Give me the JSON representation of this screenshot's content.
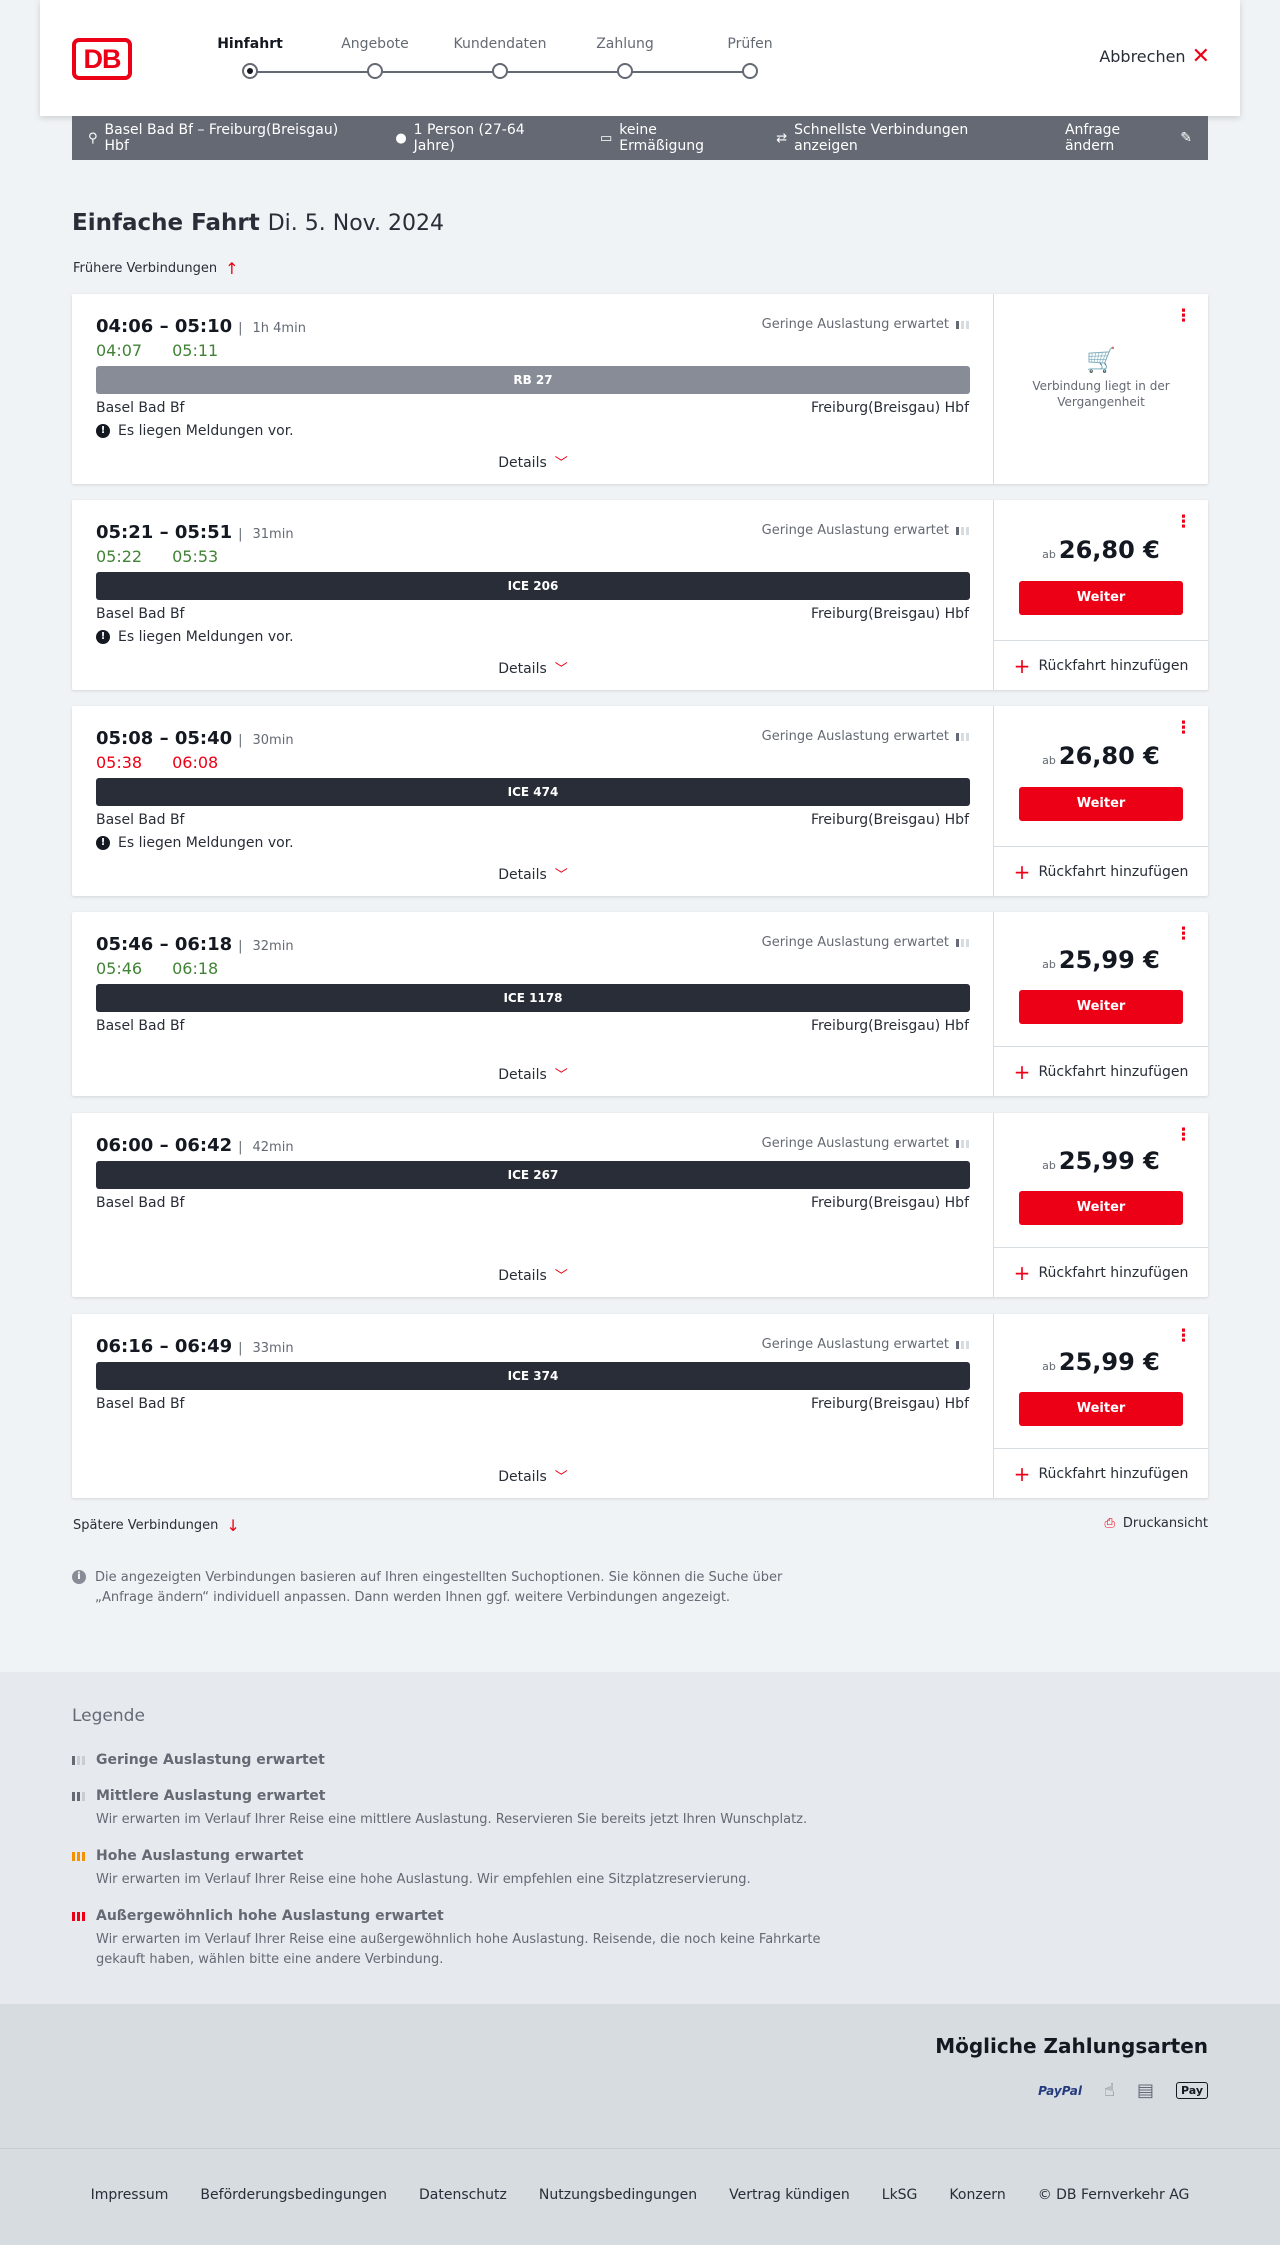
{
  "header": {
    "logo": "DB",
    "steps": [
      "Hinfahrt",
      "Angebote",
      "Kundendaten",
      "Zahlung",
      "Prüfen"
    ],
    "active_step": 0,
    "cancel_label": "Abbrechen"
  },
  "query": {
    "route": "Basel Bad Bf – Freiburg(Breisgau) Hbf",
    "persons": "1 Person (27-64 Jahre)",
    "discount": "keine Ermäßigung",
    "fastest": "Schnellste Verbindungen anzeigen",
    "change": "Anfrage ändern"
  },
  "title": {
    "main": "Einfache Fahrt",
    "date": "Di. 5. Nov. 2024"
  },
  "earlier": "Frühere Verbindungen",
  "later": "Spätere Verbindungen",
  "print": "Druckansicht",
  "load_text": "Geringe Auslastung erwartet",
  "details_label": "Details",
  "message_text": "Es liegen Meldungen vor.",
  "from": "Basel Bad Bf",
  "to": "Freiburg(Breisgau) Hbf",
  "ab": "ab",
  "weiter": "Weiter",
  "rueckfahrt": "Rückfahrt hinzufügen",
  "past_text": "Verbindung liegt in der Vergangenheit",
  "connections": [
    {
      "times": "04:06 – 05:10",
      "duration": "1h 4min",
      "rt_dep": "04:07",
      "rt_arr": "05:11",
      "train": "RB 27",
      "price": "",
      "past": true
    },
    {
      "times": "05:21 – 05:51",
      "duration": "31min",
      "rt_dep": "05:22",
      "rt_arr": "05:53",
      "train": "ICE 206",
      "price": "26,80 €"
    },
    {
      "times": "05:08 – 05:40",
      "duration": "30min",
      "rt_dep": "05:38",
      "rt_arr": "06:08",
      "train": "ICE 474",
      "price": "26,80 €"
    },
    {
      "times": "05:46 – 06:18",
      "duration": "32min",
      "rt_dep": "05:46",
      "rt_arr": "06:18",
      "train": "ICE 1178",
      "price": "25,99 €"
    },
    {
      "times": "06:00 – 06:42",
      "duration": "42min",
      "train": "ICE 267",
      "price": "25,99 €"
    },
    {
      "times": "06:16 – 06:49",
      "duration": "33min",
      "train": "ICE 374",
      "price": "25,99 €"
    }
  ],
  "info": "Die angezeigten Verbindungen basieren auf Ihren eingestellten Suchoptionen. Sie können die Suche über „Anfrage ändern“ individuell anpassen. Dann werden Ihnen ggf. weitere Verbindungen angezeigt.",
  "legend": {
    "title": "Legende",
    "items": [
      {
        "title": "Geringe Auslastung erwartet",
        "desc": ""
      },
      {
        "title": "Mittlere Auslastung erwartet",
        "desc": "Wir erwarten im Verlauf Ihrer Reise eine mittlere Auslastung. Reservieren Sie bereits jetzt Ihren Wunschplatz."
      },
      {
        "title": "Hohe Auslastung erwartet",
        "desc": "Wir erwarten im Verlauf Ihrer Reise eine hohe Auslastung. Wir empfehlen eine Sitzplatzreservierung."
      },
      {
        "title": "Außergewöhnlich hohe Auslastung erwartet",
        "desc": "Wir erwarten im Verlauf Ihrer Reise eine außergewöhnlich hohe Auslastung. Reisende, die noch keine Fahrkarte gekauft haben, wählen bitte eine andere Verbindung."
      }
    ]
  },
  "payment": {
    "title": "Mögliche Zahlungsarten",
    "paypal": "PayPal",
    "applepay": "Pay"
  },
  "footer": [
    "Impressum",
    "Beförderungsbedingungen",
    "Datenschutz",
    "Nutzungsbedingungen",
    "Vertrag kündigen",
    "LkSG",
    "Konzern",
    "© DB Fernverkehr AG"
  ],
  "colors": {
    "accent": "#ec0016",
    "on_time": "#408335",
    "delayed": "#ec0016",
    "load_orange": "#f39200"
  }
}
